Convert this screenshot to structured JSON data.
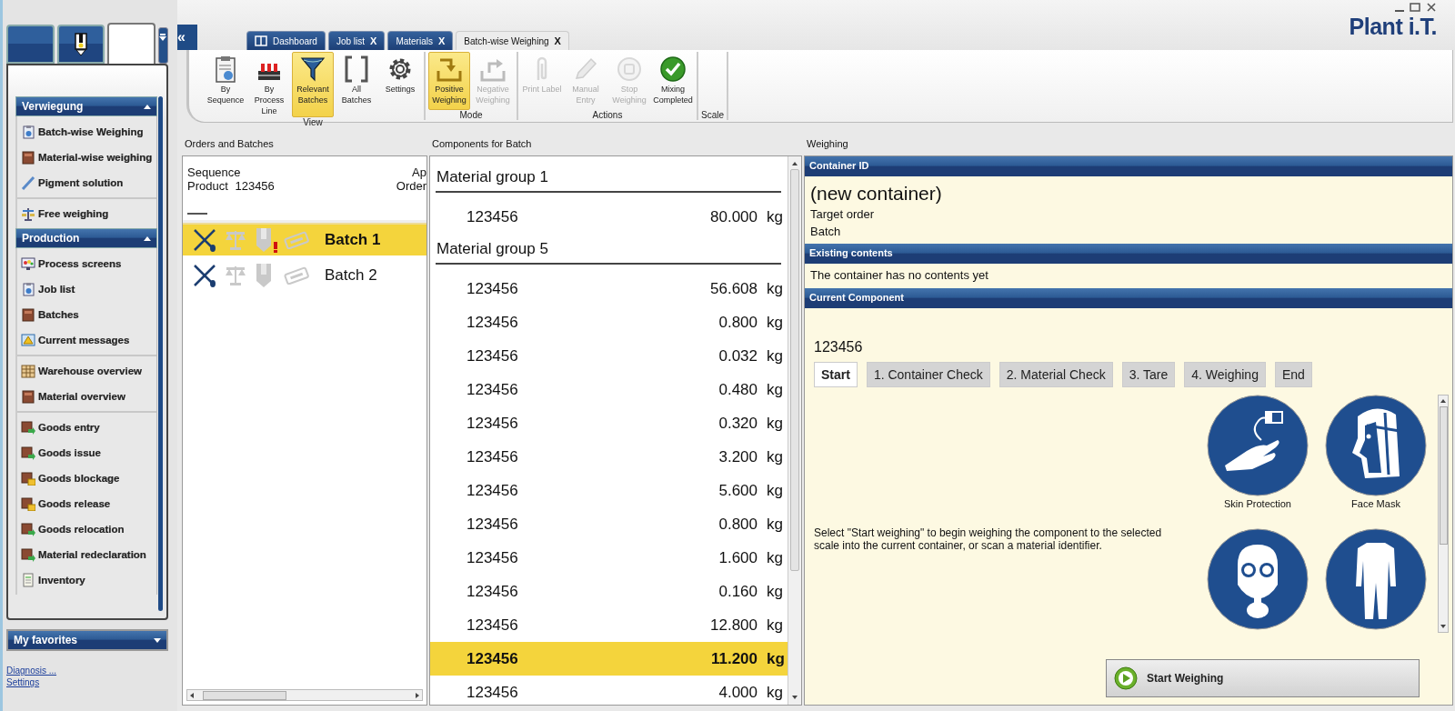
{
  "nav_tabs": [
    {
      "selected": false
    },
    {
      "selected": false
    },
    {
      "selected": true
    }
  ],
  "sidebar": {
    "groups": [
      {
        "title": "Verwiegung",
        "expanded": true,
        "sections": [
          [
            "Batch-wise Weighing",
            "Material-wise weighing",
            "Pigment solution"
          ],
          [
            "Free weighing"
          ]
        ]
      },
      {
        "title": "Production",
        "expanded": true,
        "sections": [
          [
            "Process screens",
            "Job list",
            "Batches",
            "Current messages"
          ],
          [
            "Warehouse overview",
            "Material overview"
          ],
          [
            "Goods entry",
            "Goods issue",
            "Goods blockage",
            "Goods release",
            "Goods relocation",
            "Material redeclaration",
            "Inventory"
          ]
        ]
      }
    ]
  },
  "favorites": {
    "title": "My favorites",
    "expanded": false
  },
  "links": [
    "Diagnosis ...",
    "Settings"
  ],
  "collapse_button": "«",
  "tabs": [
    {
      "label": "Dashboard",
      "selected": false
    },
    {
      "label": "Job list",
      "close": "X",
      "selected": false
    },
    {
      "label": "Materials",
      "close": "X",
      "selected": false
    },
    {
      "label": "Batch-wise Weighing",
      "close": "X",
      "selected": true
    }
  ],
  "logo": "Plant i.T.",
  "ribbon": {
    "groups": [
      {
        "title": "View",
        "buttons": [
          {
            "label": "By Sequence",
            "selected": false,
            "disabled": false
          },
          {
            "label": "By Process Line",
            "selected": false,
            "disabled": false
          },
          {
            "label": "Relevant Batches",
            "selected": true,
            "disabled": false
          },
          {
            "label": "All Batches",
            "selected": false,
            "disabled": false
          },
          {
            "label": "Settings",
            "selected": false,
            "disabled": false
          }
        ]
      },
      {
        "title": "Mode",
        "buttons": [
          {
            "label": "Positive Weighing",
            "selected": true,
            "disabled": false
          },
          {
            "label": "Negative Weighing",
            "selected": false,
            "disabled": true
          }
        ]
      },
      {
        "title": "Actions",
        "buttons": [
          {
            "label": "Print Label",
            "selected": false,
            "disabled": true
          },
          {
            "label": "Manual Entry",
            "selected": false,
            "disabled": true
          },
          {
            "label": "Stop Weighing",
            "selected": false,
            "disabled": true
          },
          {
            "label": "Mixing Completed",
            "selected": false,
            "disabled": false
          }
        ]
      },
      {
        "title": "Scale"
      }
    ]
  },
  "orders": {
    "title": "Orders and Batches",
    "sequence": "Sequence",
    "product_label": "Product",
    "product_value": "123456",
    "column_2": [
      "Ap",
      "Order"
    ],
    "batches": [
      {
        "label": "Batch 1",
        "selected": true,
        "warning": true
      },
      {
        "label": "Batch 2",
        "selected": false,
        "warning": false
      }
    ]
  },
  "components": {
    "title": "Components for Batch",
    "groups": [
      {
        "title": "Material group 1",
        "rows": [
          {
            "material": "123456",
            "amount": "80.000",
            "unit": "kg",
            "selected": false
          }
        ]
      },
      {
        "title": "Material group 5",
        "rows": [
          {
            "material": "123456",
            "amount": "56.608",
            "unit": "kg",
            "selected": false
          },
          {
            "material": "123456",
            "amount": "0.800",
            "unit": "kg",
            "selected": false
          },
          {
            "material": "123456",
            "amount": "0.032",
            "unit": "kg",
            "selected": false
          },
          {
            "material": "123456",
            "amount": "0.480",
            "unit": "kg",
            "selected": false
          },
          {
            "material": "123456",
            "amount": "0.320",
            "unit": "kg",
            "selected": false
          },
          {
            "material": "123456",
            "amount": "3.200",
            "unit": "kg",
            "selected": false
          },
          {
            "material": "123456",
            "amount": "5.600",
            "unit": "kg",
            "selected": false
          },
          {
            "material": "123456",
            "amount": "0.800",
            "unit": "kg",
            "selected": false
          },
          {
            "material": "123456",
            "amount": "1.600",
            "unit": "kg",
            "selected": false
          },
          {
            "material": "123456",
            "amount": "0.160",
            "unit": "kg",
            "selected": false
          },
          {
            "material": "123456",
            "amount": "12.800",
            "unit": "kg",
            "selected": false
          },
          {
            "material": "123456",
            "amount": "11.200",
            "unit": "kg",
            "selected": true
          },
          {
            "material": "123456",
            "amount": "4.000",
            "unit": "kg",
            "selected": false
          }
        ]
      }
    ]
  },
  "weighing": {
    "title": "Weighing",
    "container_header": "Container ID",
    "container_name": "(new container)",
    "container_lines": [
      "Target order",
      "Batch"
    ],
    "contents_header": "Existing contents",
    "contents_text": "The container has no contents yet",
    "component_header": "Current Component",
    "component_id": "123456",
    "steps": [
      {
        "label": "Start",
        "selected": true
      },
      {
        "label": "1. Container Check",
        "selected": false
      },
      {
        "label": "2. Material Check",
        "selected": false
      },
      {
        "label": "3. Tare",
        "selected": false
      },
      {
        "label": "4. Weighing",
        "selected": false
      },
      {
        "label": "End",
        "selected": false
      }
    ],
    "instruction": "Select \"Start weighing\" to begin weighing the component to the selected scale into the current container, or scan a material identifier.",
    "ppe": [
      {
        "kind": "skin",
        "label": "Skin Protection"
      },
      {
        "kind": "face_mask",
        "label": "Face Mask"
      },
      {
        "kind": "respirator"
      },
      {
        "kind": "coverall"
      }
    ],
    "start_button": "Start Weighing"
  }
}
